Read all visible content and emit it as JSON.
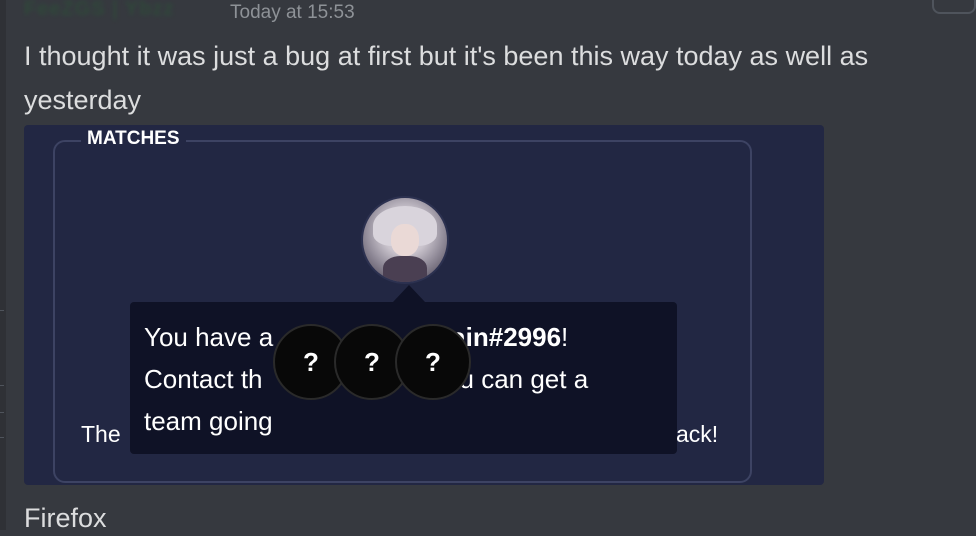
{
  "header": {
    "author": "FeeZGS | Ybzz",
    "timestamp": "Today at 15:53"
  },
  "message": {
    "text": "I thought it was just a bug at first but it's been this way today as well as yesterday",
    "next_message": "Firefox"
  },
  "embed": {
    "section_title": "MATCHES",
    "footer_left": "The",
    "footer_right": "ack!",
    "tooltip": {
      "line1_a": "You have a",
      "line1_b": "ain#2996",
      "line1_c": "!",
      "line2_a": "Contact th",
      "line2_b": "u can get a",
      "line3": "team going"
    },
    "unknown_members": [
      {
        "label": "?"
      },
      {
        "label": "?"
      },
      {
        "label": "?"
      }
    ]
  },
  "colors": {
    "background": "#36393f",
    "embed_background": "#222743",
    "tooltip_background": "#0f1226",
    "message_text": "#dcddde",
    "timestamp": "#8e9297"
  },
  "icons": {
    "avatar": "anime-avatar-image"
  }
}
